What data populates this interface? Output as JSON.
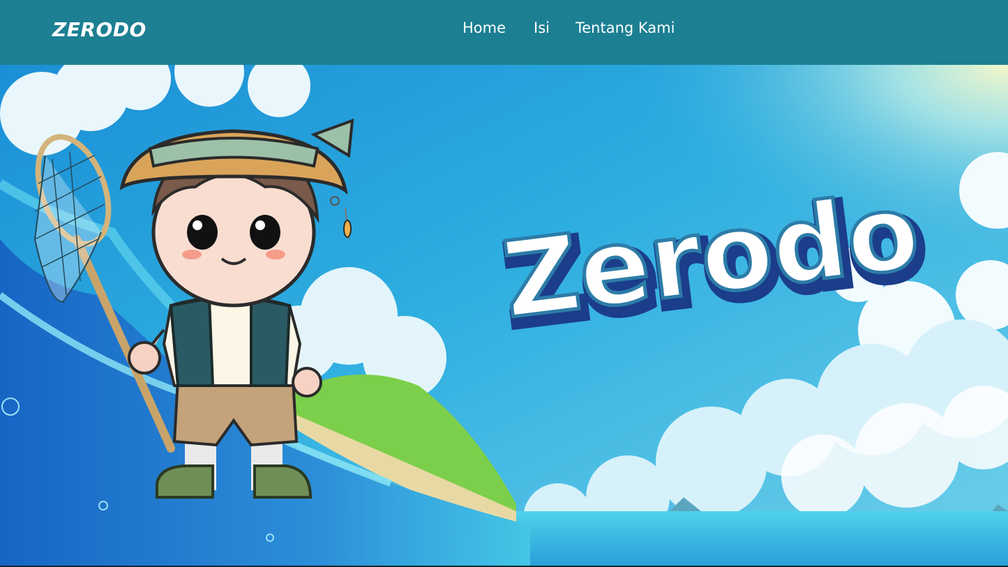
{
  "navbar": {
    "brand": "ZERODO",
    "links": [
      {
        "label": "Home"
      },
      {
        "label": "Isi"
      },
      {
        "label": "Tentang Kami"
      }
    ],
    "bg_color": "#1c7f92"
  },
  "hero": {
    "logo_text": "Zerodo",
    "sky_color": "#29a6d8",
    "logo_outline_color": "#1b3d8a",
    "character": "chibi-fisher-boy",
    "held_item": "fishing-net"
  }
}
